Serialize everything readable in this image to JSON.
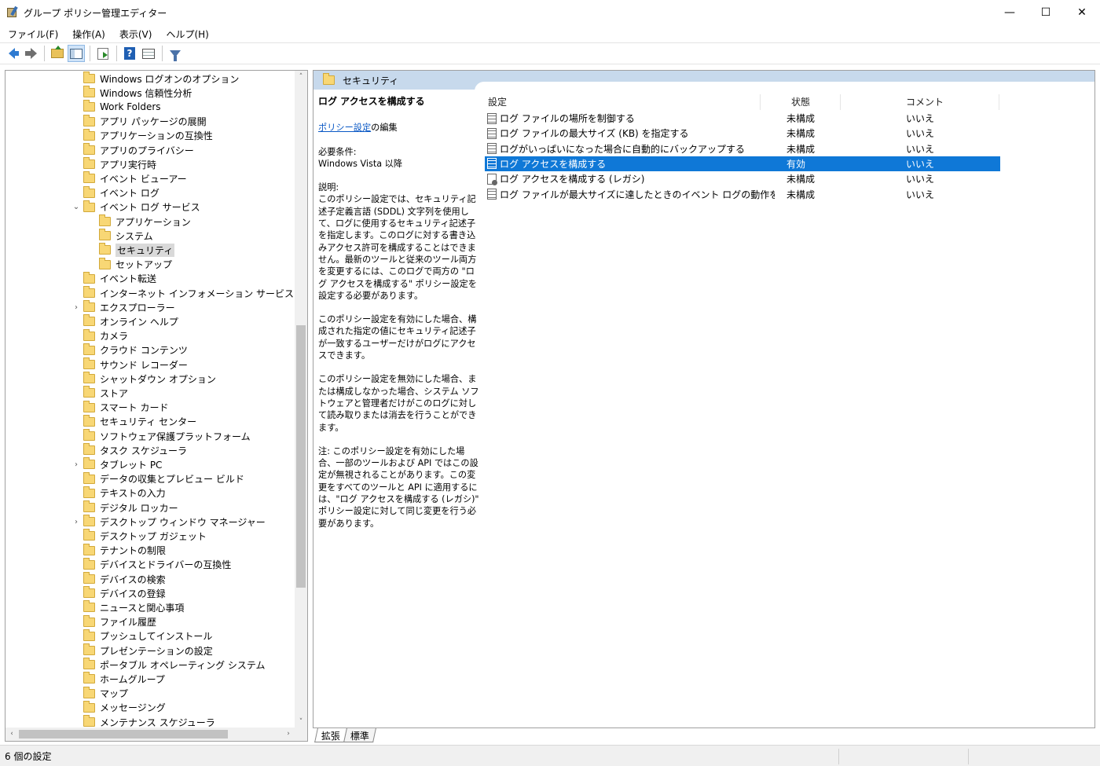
{
  "window": {
    "title": "グループ ポリシー管理エディター",
    "controls": {
      "minimize": "—",
      "maximize": "☐",
      "close": "✕"
    }
  },
  "menu": [
    "ファイル(F)",
    "操作(A)",
    "表示(V)",
    "ヘルプ(H)"
  ],
  "toolbar": [
    "back-icon",
    "forward-icon",
    "up-folder-icon",
    "show-hide-tree-icon",
    "export-list-icon",
    "help-icon",
    "properties-icon",
    "filter-icon"
  ],
  "tree": {
    "items": [
      {
        "label": "Windows ログオンのオプション",
        "level": 1,
        "expander": ""
      },
      {
        "label": "Windows 信頼性分析",
        "level": 1,
        "expander": ""
      },
      {
        "label": "Work Folders",
        "level": 1,
        "expander": ""
      },
      {
        "label": "アプリ パッケージの展開",
        "level": 1,
        "expander": ""
      },
      {
        "label": "アプリケーションの互換性",
        "level": 1,
        "expander": ""
      },
      {
        "label": "アプリのプライバシー",
        "level": 1,
        "expander": ""
      },
      {
        "label": "アプリ実行時",
        "level": 1,
        "expander": ""
      },
      {
        "label": "イベント ビューアー",
        "level": 1,
        "expander": ""
      },
      {
        "label": "イベント ログ",
        "level": 1,
        "expander": ""
      },
      {
        "label": "イベント ログ サービス",
        "level": 1,
        "expander": "⌄"
      },
      {
        "label": "アプリケーション",
        "level": 2,
        "expander": ""
      },
      {
        "label": "システム",
        "level": 2,
        "expander": ""
      },
      {
        "label": "セキュリティ",
        "level": 2,
        "expander": "",
        "selected": true
      },
      {
        "label": "セットアップ",
        "level": 2,
        "expander": ""
      },
      {
        "label": "イベント転送",
        "level": 1,
        "expander": ""
      },
      {
        "label": "インターネット インフォメーション サービス",
        "level": 1,
        "expander": ""
      },
      {
        "label": "エクスプローラー",
        "level": 1,
        "expander": "›"
      },
      {
        "label": "オンライン ヘルプ",
        "level": 1,
        "expander": ""
      },
      {
        "label": "カメラ",
        "level": 1,
        "expander": ""
      },
      {
        "label": "クラウド コンテンツ",
        "level": 1,
        "expander": ""
      },
      {
        "label": "サウンド レコーダー",
        "level": 1,
        "expander": ""
      },
      {
        "label": "シャットダウン オプション",
        "level": 1,
        "expander": ""
      },
      {
        "label": "ストア",
        "level": 1,
        "expander": ""
      },
      {
        "label": "スマート カード",
        "level": 1,
        "expander": ""
      },
      {
        "label": "セキュリティ センター",
        "level": 1,
        "expander": ""
      },
      {
        "label": "ソフトウェア保護プラットフォーム",
        "level": 1,
        "expander": ""
      },
      {
        "label": "タスク スケジューラ",
        "level": 1,
        "expander": ""
      },
      {
        "label": "タブレット PC",
        "level": 1,
        "expander": "›"
      },
      {
        "label": "データの収集とプレビュー ビルド",
        "level": 1,
        "expander": ""
      },
      {
        "label": "テキストの入力",
        "level": 1,
        "expander": ""
      },
      {
        "label": "デジタル ロッカー",
        "level": 1,
        "expander": ""
      },
      {
        "label": "デスクトップ ウィンドウ マネージャー",
        "level": 1,
        "expander": "›"
      },
      {
        "label": "デスクトップ ガジェット",
        "level": 1,
        "expander": ""
      },
      {
        "label": "テナントの制限",
        "level": 1,
        "expander": ""
      },
      {
        "label": "デバイスとドライバーの互換性",
        "level": 1,
        "expander": ""
      },
      {
        "label": "デバイスの検索",
        "level": 1,
        "expander": ""
      },
      {
        "label": "デバイスの登録",
        "level": 1,
        "expander": ""
      },
      {
        "label": "ニュースと関心事項",
        "level": 1,
        "expander": ""
      },
      {
        "label": "ファイル履歴",
        "level": 1,
        "expander": ""
      },
      {
        "label": "プッシュしてインストール",
        "level": 1,
        "expander": ""
      },
      {
        "label": "プレゼンテーションの設定",
        "level": 1,
        "expander": ""
      },
      {
        "label": "ポータブル オペレーティング システム",
        "level": 1,
        "expander": ""
      },
      {
        "label": "ホームグループ",
        "level": 1,
        "expander": ""
      },
      {
        "label": "マップ",
        "level": 1,
        "expander": ""
      },
      {
        "label": "メッセージング",
        "level": 1,
        "expander": ""
      },
      {
        "label": "メンテナンス スケジューラ",
        "level": 1,
        "expander": ""
      }
    ],
    "scroll_up": "˄",
    "scroll_down": "˅",
    "scroll_left": "‹",
    "scroll_right": "›"
  },
  "right": {
    "header_title": "セキュリティ",
    "description": {
      "title": "ログ アクセスを構成する",
      "link": "ポリシー設定",
      "link_suffix": "の編集",
      "req_label": "必要条件:",
      "req_value": "Windows Vista 以降",
      "desc_label": "説明:",
      "desc_p1": "このポリシー設定では、セキュリティ記述子定義言語 (SDDL) 文字列を使用して、ログに使用するセキュリティ記述子を指定します。このログに対する書き込みアクセス許可を構成することはできません。最新のツールと従来のツール両方を変更するには、このログで両方の \"ログ アクセスを構成する\" ポリシー設定を設定する必要があります。",
      "desc_p2": "このポリシー設定を有効にした場合、構成された指定の値にセキュリティ記述子が一致するユーザーだけがログにアクセスできます。",
      "desc_p3": "このポリシー設定を無効にした場合、または構成しなかった場合、システム ソフトウェアと管理者だけがこのログに対して読み取りまたは消去を行うことができます。",
      "desc_p4": "注: このポリシー設定を有効にした場合、一部のツールおよび API ではこの設定が無視されることがあります。この変更をすべてのツールと API に適用するには、\"ログ アクセスを構成する (レガシ)\" ポリシー設定に対して同じ変更を行う必要があります。"
    },
    "columns": {
      "setting": "設定",
      "state": "状態",
      "comment": "コメント"
    },
    "rows": [
      {
        "name": "ログ ファイルの場所を制御する",
        "state": "未構成",
        "comment": "いいえ",
        "icon": "policy-setting-icon"
      },
      {
        "name": "ログ ファイルの最大サイズ (KB) を指定する",
        "state": "未構成",
        "comment": "いいえ",
        "icon": "policy-setting-icon"
      },
      {
        "name": "ログがいっぱいになった場合に自動的にバックアップする",
        "state": "未構成",
        "comment": "いいえ",
        "icon": "policy-setting-icon"
      },
      {
        "name": "ログ アクセスを構成する",
        "state": "有効",
        "comment": "いいえ",
        "icon": "policy-setting-icon",
        "selected": true
      },
      {
        "name": "ログ アクセスを構成する (レガシ)",
        "state": "未構成",
        "comment": "いいえ",
        "icon": "legacy-policy-icon"
      },
      {
        "name": "ログ ファイルが最大サイズに達したときのイベント ログの動作を制御する",
        "state": "未構成",
        "comment": "いいえ",
        "icon": "policy-setting-icon"
      }
    ]
  },
  "tabs": [
    "拡張",
    "標準"
  ],
  "status": "6 個の設定",
  "colors": {
    "selection": "#0f78d7",
    "header_band": "#c7d9ec",
    "folder": "#f8d775",
    "link": "#0a58c5"
  }
}
